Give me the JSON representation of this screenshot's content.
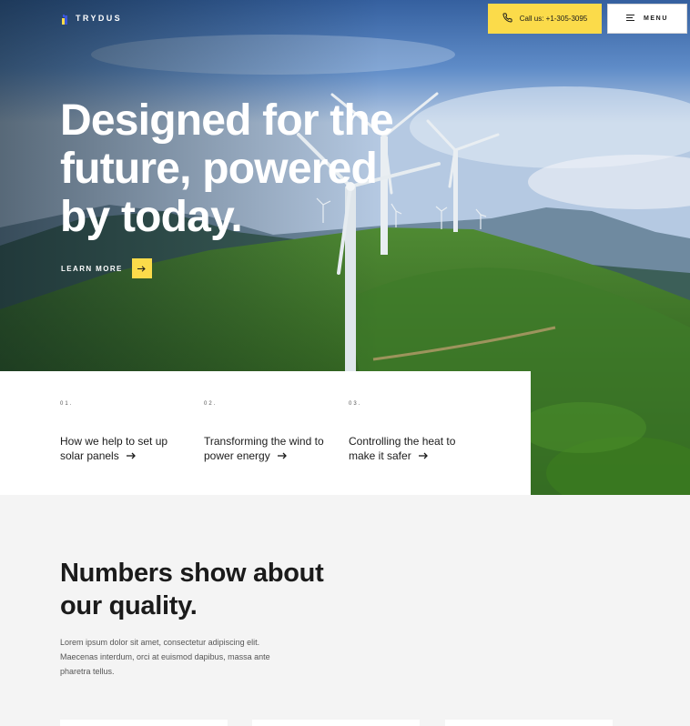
{
  "brand": {
    "name": "TRYDUS",
    "accent": "#fbdb4a",
    "logo_blue": "#3a56d9"
  },
  "header": {
    "call_label": "Call us: +1-305-3095",
    "menu_label": "MENU",
    "phone_icon": "phone-icon",
    "menu_icon": "hamburger-icon"
  },
  "hero": {
    "title": "Designed for the future, powered by today.",
    "cta_label": "LEARN MORE",
    "cta_icon": "arrow-right-icon"
  },
  "features": [
    {
      "number": "01.",
      "title": "How we help to set up solar panels"
    },
    {
      "number": "02.",
      "title": "Transforming the wind to power energy"
    },
    {
      "number": "03.",
      "title": "Controlling the heat to make it safer"
    }
  ],
  "stats": {
    "title": "Numbers show about our quality.",
    "body": "Lorem ipsum dolor sit amet, consectetur adipiscing elit. Maecenas interdum, orci at euismod dapibus, massa ante pharetra tellus."
  }
}
